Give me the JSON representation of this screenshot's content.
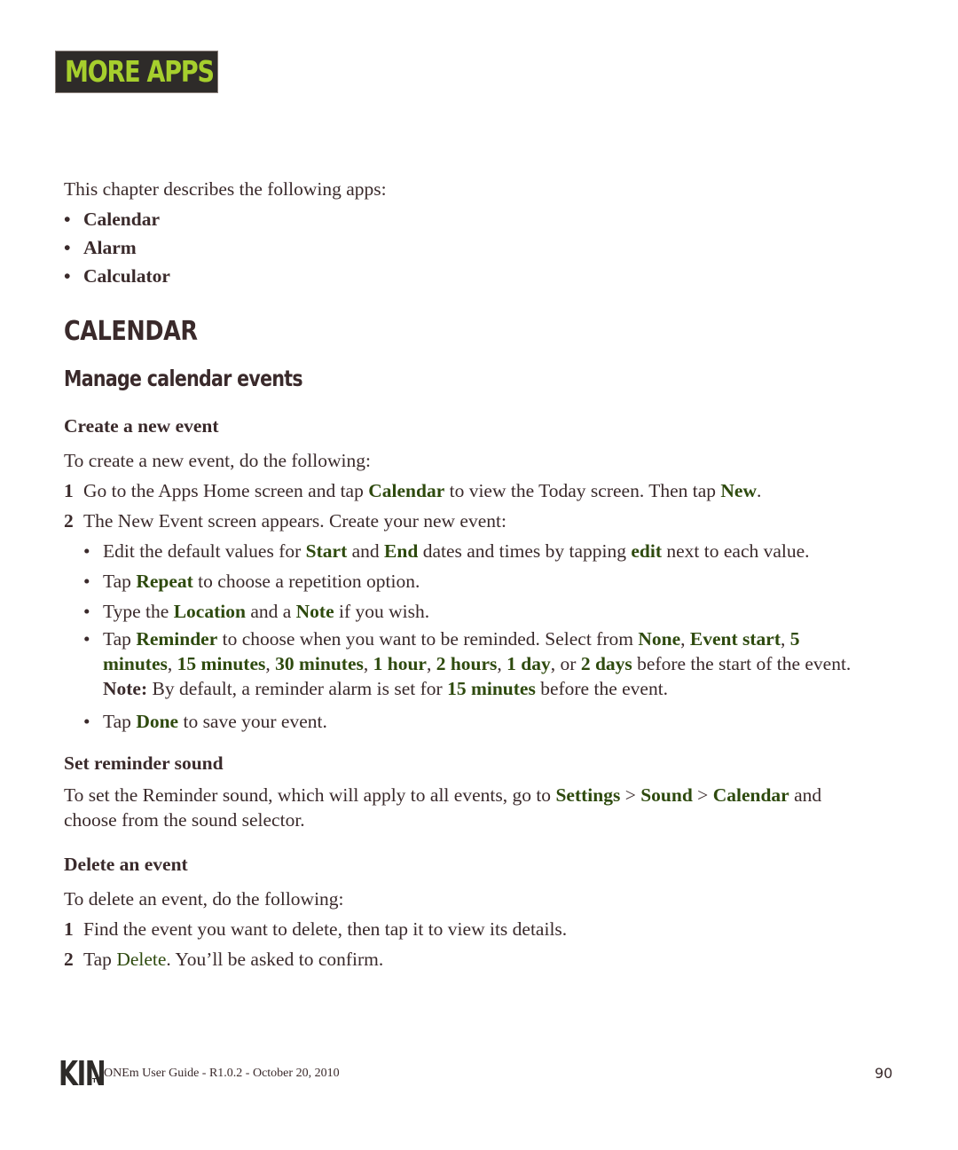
{
  "chapter": {
    "title": "MORE APPS"
  },
  "intro": {
    "text": "This chapter describes the following apps:",
    "apps": [
      "Calendar",
      "Alarm",
      "Calculator"
    ]
  },
  "section": {
    "title": "CALENDAR",
    "subtitle": "Manage calendar events"
  },
  "create_event": {
    "heading": "Create a new event",
    "lead": "To create a new event, do the following:",
    "step1": {
      "num": "1",
      "t1": "Go to the Apps Home screen and tap ",
      "k1": "Calendar",
      "t2": " to view the Today screen. Then tap ",
      "k2": "New",
      "t3": "."
    },
    "step2": {
      "num": "2",
      "text": "The New Event screen appears. Create your new event:"
    },
    "bullets": {
      "b1": {
        "t1": "Edit the default values for ",
        "k1": "Start",
        "t2": " and ",
        "k2": "End",
        "t3": " dates and times by tapping ",
        "k3": "edit",
        "t4": " next to each value."
      },
      "b2": {
        "t1": "Tap ",
        "k1": "Repeat",
        "t2": " to choose a repetition option."
      },
      "b3": {
        "t1": "Type the ",
        "k1": "Location",
        "t2": " and a ",
        "k2": "Note",
        "t3": " if you wish."
      },
      "b4": {
        "t1": "Tap ",
        "k1": "Reminder",
        "t2": " to choose when you want to be reminded. Select from ",
        "k2": "None",
        "c1": ", ",
        "k3": "Event start",
        "c2": ", ",
        "k4a": "5",
        "k4b": "minutes",
        "c3": ", ",
        "k5": "15 minutes",
        "c4": ", ",
        "k6": "30 minutes",
        "c5": ", ",
        "k7": "1 hour",
        "c6": ", ",
        "k8": "2 hours",
        "c7": ", ",
        "k9": "1 day",
        "c8": ", or ",
        "k10": "2 days",
        "t3": " before the start of the event.",
        "note_label": "Note:",
        "t4": " By default, a reminder alarm is set for ",
        "k11": "15 minutes",
        "t5": " before the event."
      },
      "b5": {
        "t1": "Tap ",
        "k1": "Done",
        "t2": " to save your event."
      }
    },
    "bullet_char": "•"
  },
  "reminder_sound": {
    "heading": "Set reminder sound",
    "t1": "To set the Reminder sound, which will apply to all events, go to ",
    "k1": "Settings",
    "sep1": " > ",
    "k2": "Sound",
    "sep2": " > ",
    "k3": "Calendar",
    "t2": " and",
    "line2": "choose from the sound selector."
  },
  "delete_event": {
    "heading": "Delete an event",
    "lead": "To delete an event, do the following:",
    "step1": {
      "num": "1",
      "text": "Find the event you want to delete, then tap it to view its details."
    },
    "step2": {
      "num": "2",
      "t1": "Tap ",
      "k1": "Delete",
      "t2": ". You’ll be asked to confirm."
    }
  },
  "footer": {
    "logo": "KIN",
    "tm": "TM",
    "text": "ONEm User Guide - R1.0.2 - October 20, 2010",
    "page": "90"
  }
}
